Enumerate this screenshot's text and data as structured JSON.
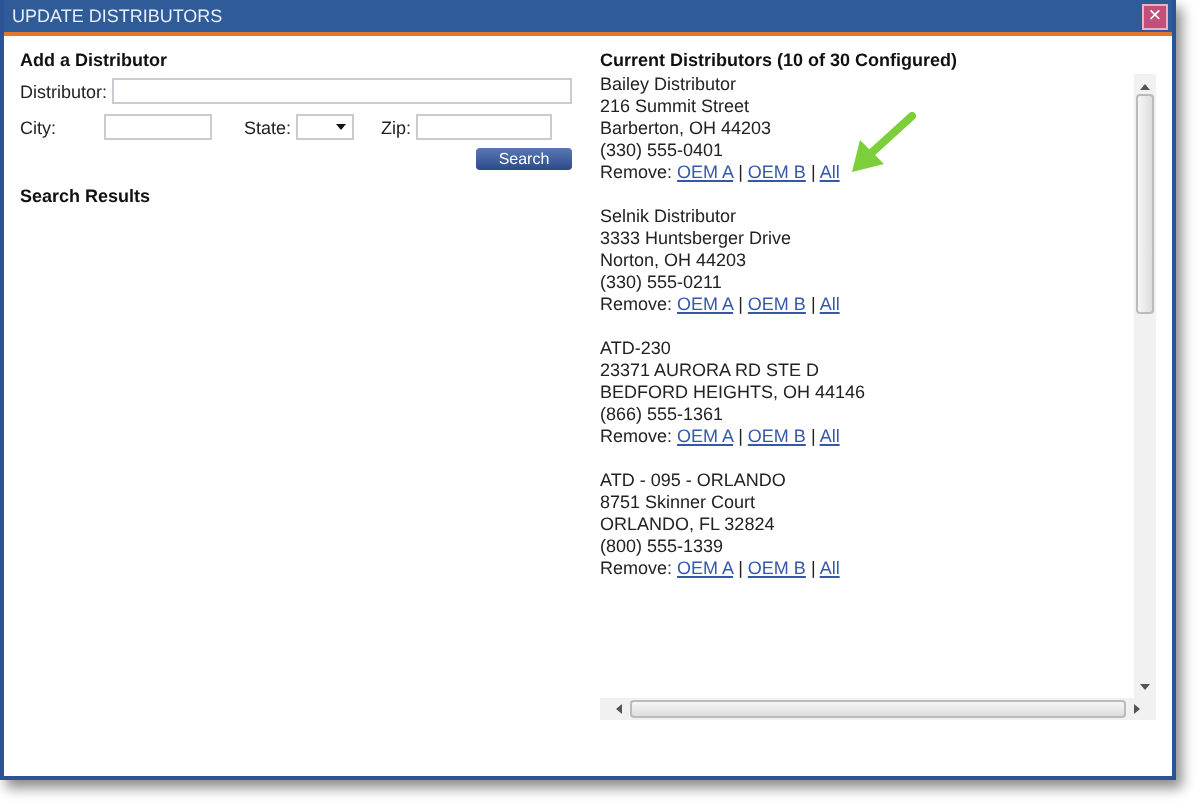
{
  "window": {
    "title": "UPDATE DISTRIBUTORS",
    "close": "×"
  },
  "add_form": {
    "title": "Add a Distributor",
    "distributor_label": "Distributor:",
    "city_label": "City:",
    "state_label": "State:",
    "zip_label": "Zip:",
    "search_button": "Search"
  },
  "search_results": {
    "title": "Search Results"
  },
  "current": {
    "title": "Current Distributors (10 of 30 Configured)",
    "distributors": [
      {
        "name": "Bailey Distributor",
        "lines": [
          "216 Summit Street",
          "Barberton, OH 44203",
          "(330) 555-0401"
        ],
        "remove_label": "Remove:",
        "links": [
          "OEM A",
          "OEM B",
          "All"
        ],
        "separators": [
          "|",
          "|"
        ]
      },
      {
        "name": "Selnik Distributor",
        "lines": [
          "3333 Huntsberger Drive",
          "Norton, OH 44203",
          "(330) 555-0211"
        ],
        "remove_label": "Remove:",
        "links": [
          "OEM A",
          "OEM B",
          "All"
        ],
        "separators": [
          "|",
          "|"
        ]
      },
      {
        "name": "ATD-230",
        "lines": [
          "23371 AURORA RD STE D",
          "BEDFORD HEIGHTS, OH  44146",
          "(866) 555-1361"
        ],
        "remove_label": "Remove:",
        "links": [
          "OEM A",
          "OEM B",
          "All"
        ],
        "separators": [
          "|",
          "|"
        ]
      },
      {
        "name": "ATD - 095 - ORLANDO",
        "lines": [
          "8751 Skinner Court",
          "ORLANDO, FL  32824",
          "(800) 555-1339"
        ],
        "remove_label": "Remove:",
        "links": [
          "OEM A",
          "OEM B",
          "All"
        ],
        "separators": [
          "|",
          "|"
        ]
      }
    ]
  }
}
